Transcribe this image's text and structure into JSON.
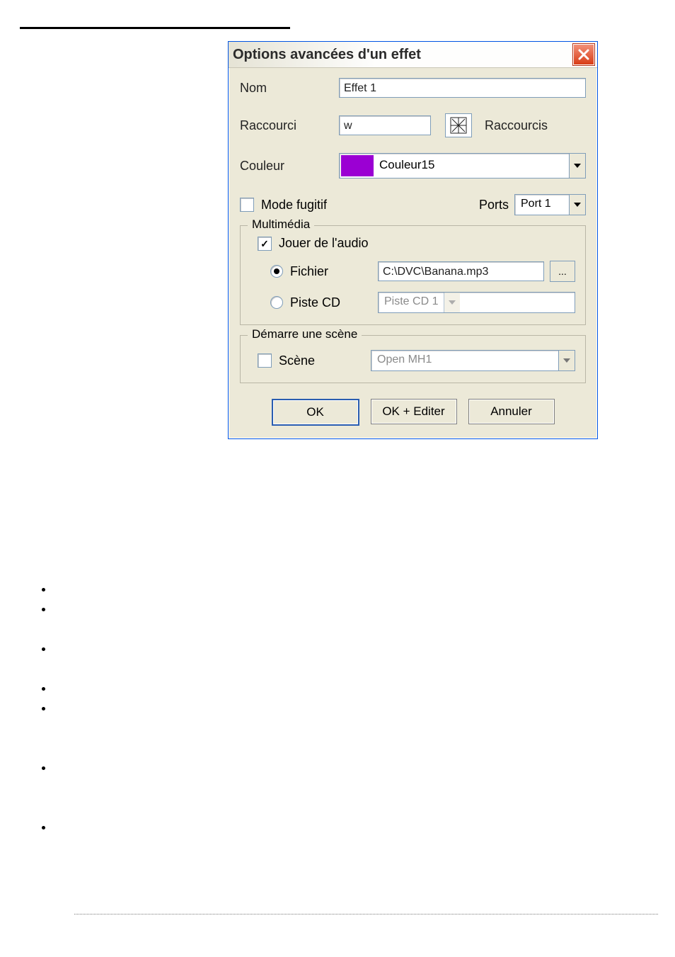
{
  "dialog": {
    "title": "Options avancées d'un effet",
    "nom_label": "Nom",
    "nom_value": "Effet 1",
    "raccourci_label": "Raccourci",
    "raccourci_value": "w",
    "raccourcis_link": "Raccourcis",
    "couleur_label": "Couleur",
    "couleur_name": "Couleur15",
    "couleur_hex": "#9b00d3",
    "mode_fugitif_label": "Mode fugitif",
    "mode_fugitif_checked": false,
    "ports_label": "Ports",
    "ports_value": "Port 1",
    "multimedia": {
      "legend": "Multimédia",
      "play_audio_label": "Jouer de l'audio",
      "play_audio_checked": true,
      "fichier_label": "Fichier",
      "fichier_selected": true,
      "fichier_value": "C:\\DVC\\Banana.mp3",
      "browse_label": "...",
      "piste_label": "Piste CD",
      "piste_selected": false,
      "piste_value": "Piste CD 1"
    },
    "scene": {
      "legend": "Démarre une scène",
      "scene_label": "Scène",
      "scene_checked": false,
      "scene_value": "Open MH1"
    },
    "buttons": {
      "ok": "OK",
      "ok_edit": "OK + Editer",
      "cancel": "Annuler"
    }
  }
}
